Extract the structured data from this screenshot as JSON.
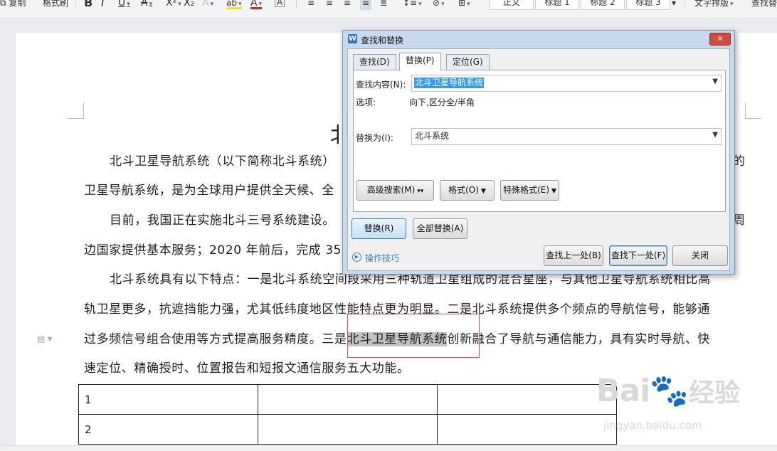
{
  "toolbar": {
    "copy": "复制",
    "format_painter": "格式刷",
    "bold": "B",
    "italic": "I",
    "underline": "U",
    "strikethrough": "A",
    "superscript": "X²",
    "subscript": "X₂",
    "font_effect": "A",
    "highlight": "ab",
    "font_color": "A",
    "char_border": "A",
    "styles": [
      "正文",
      "标题 1",
      "标题 2",
      "标题 3"
    ],
    "text_layout": "文字排版",
    "find_replace": "查找替"
  },
  "document": {
    "title": "北",
    "paragraphs": [
      "北斗卫星导航系统（以下简称北斗系统）",
      "卫星导航系统，是为全球用户提供全天候、全",
      "目前，我国正在实施北斗三号系统建设。",
      "边国家提供基本服务；2020 年前后，完成 35",
      "北斗系统具有以下特点：一是北斗系统空间段采用三种轨道卫星组成的混合星座，与其他卫星导航系统相比高",
      "轨卫星更多，抗遮挡能力强，尤其低纬度地区性能特点更为明显。二是北斗系统提供多个频点的导航信号，能够通",
      "速定位、精确授时、位置报告和短报文通信服务五大功能。"
    ],
    "p1_tail": "的",
    "p3_tail": "周",
    "p7_pre": "过多频信号组合使用等方式提高服务精度。三是",
    "p7_highlight": "北斗卫星导航系统",
    "p7_post": "创新融合了导航与通信能力，具有实时导航、快",
    "table": [
      [
        "1",
        "",
        ""
      ],
      [
        "2",
        "",
        ""
      ]
    ]
  },
  "watermark": {
    "logo": "Bai",
    "logo_cn": "经验",
    "url": "jingyan.baidu.com"
  },
  "dialog": {
    "title": "查找和替换",
    "app_icon": "W",
    "close": "✕",
    "tabs": [
      "查找(D)",
      "替换(P)",
      "定位(G)"
    ],
    "active_tab": 1,
    "find_label": "查找内容(N):",
    "find_value": "北斗卫星导航系统",
    "options_label": "选项:",
    "options_value": "向下,区分全/半角",
    "replace_label": "替换为(I):",
    "replace_value": "北斗系统",
    "advanced_search": "高级搜索(M)",
    "format": "格式(O)",
    "special_format": "特殊格式(E)",
    "replace_btn": "替换(R)",
    "replace_all_btn": "全部替换(A)",
    "tips": "操作技巧",
    "find_prev": "查找上一处(B)",
    "find_next": "查找下一处(F)",
    "close_btn": "关闭"
  }
}
